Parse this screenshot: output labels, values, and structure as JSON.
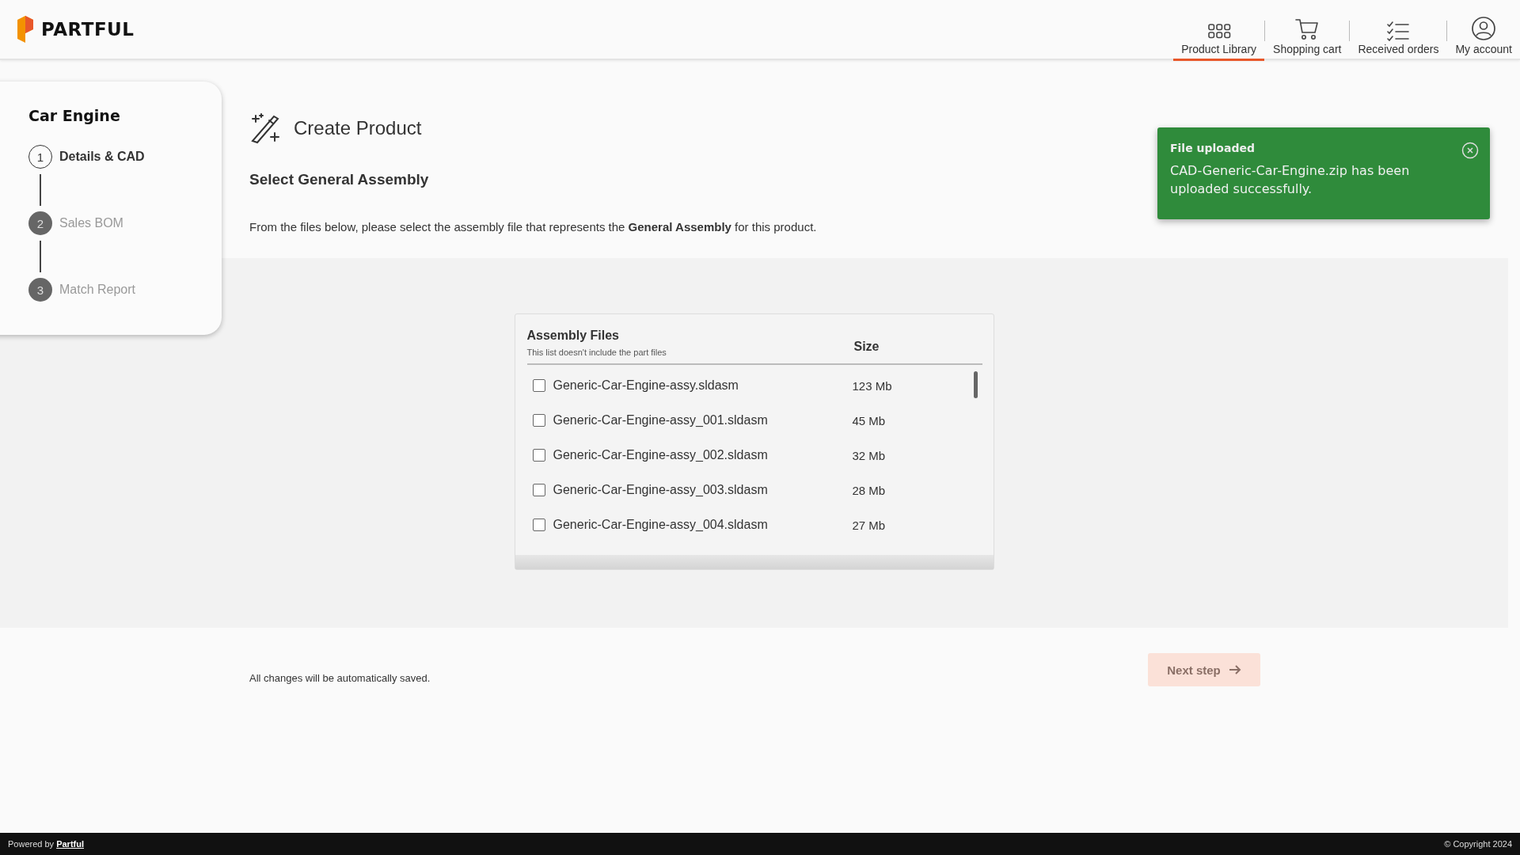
{
  "header": {
    "logo": "PARTFUL",
    "nav": [
      {
        "label": "Product Library",
        "kind": "library",
        "selected": true
      },
      {
        "label": "Shopping cart",
        "kind": "cart",
        "selected": false
      },
      {
        "label": "Received orders",
        "kind": "orders",
        "selected": false
      },
      {
        "label": "My account",
        "kind": "account",
        "selected": false
      }
    ]
  },
  "sidebar": {
    "title": "Car Engine",
    "steps": [
      {
        "number": "1",
        "label": "Details & CAD",
        "selected": true
      },
      {
        "number": "2",
        "label": "Sales BOM",
        "selected": false
      },
      {
        "number": "3",
        "label": "Match Report",
        "selected": false
      }
    ]
  },
  "page": {
    "title": "Create Product",
    "subtitle": "Select General Assembly",
    "description": "From the files below, please select the assembly file that represents the **General Assembly** for this product."
  },
  "table": {
    "title": "Assembly Files",
    "note": "This list doesn't include the part files",
    "size_column": "Size",
    "rows": [
      {
        "name": "Generic-Car-Engine-assy.sldasm",
        "size": "123 Mb",
        "checked": false
      },
      {
        "name": "Generic-Car-Engine-assy_001.sldasm",
        "size": "45 Mb",
        "checked": false
      },
      {
        "name": "Generic-Car-Engine-assy_002.sldasm",
        "size": "32 Mb",
        "checked": false
      },
      {
        "name": "Generic-Car-Engine-assy_003.sldasm",
        "size": "28 Mb",
        "checked": false
      },
      {
        "name": "Generic-Car-Engine-assy_004.sldasm",
        "size": "27 Mb",
        "checked": false
      }
    ]
  },
  "toast": {
    "title": "File uploaded",
    "message": "CAD-Generic-Car-Engine.zip has been uploaded successfully."
  },
  "footer": {
    "note": "All changes will be automatically saved.",
    "next_button": {
      "label": "Next step",
      "disabled": true
    }
  },
  "bottom_bar": {
    "powered_by": "Powered by",
    "link": "Partful",
    "copyright": "© Copyright 2024"
  }
}
